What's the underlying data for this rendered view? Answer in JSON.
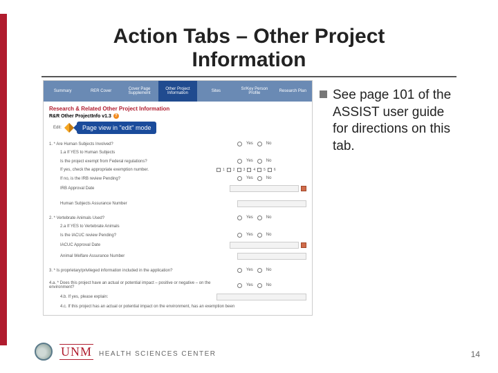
{
  "title": "Action Tabs – Other Project Information",
  "bullet_text": "See page 101 of the ASSIST user guide for directions on this tab.",
  "page_number": "14",
  "footer": {
    "unm": "UNM",
    "hsc": "HEALTH SCIENCES CENTER"
  },
  "callout": "Page view in \"edit\" mode",
  "shot": {
    "tabs": [
      "Summary",
      "RER Cover",
      "Cover Page Supplement",
      "Other Project Information",
      "Sites",
      "Sr/Key Person Profile",
      "Research Plan"
    ],
    "rr_title": "Research & Related Other Project Information",
    "rr_sub": "R&R Other ProjectInfo v1.3",
    "edit_label": "Edit:",
    "yes": "Yes",
    "no": "No",
    "q1": "1.  * Are Human Subjects Involved?",
    "q1a": "1.a If YES to Human Subjects",
    "q1a1": "Is the project exempt from Federal regulations?",
    "q1a2": "If yes, check the appropriate exemption number.",
    "q1a3": "If no, is the IRB review Pending?",
    "q1a4_lbl": "IRB Approval Date",
    "q1a5_lbl": "Human Subjects Assurance Number",
    "chk_nums": [
      "1",
      "2",
      "3",
      "4",
      "5",
      "6"
    ],
    "q2": "2.  * Vertebrate Animals Used?",
    "q2a": "2.a If YES to Vertebrate Animals",
    "q2a1": "Is the IACUC review Pending?",
    "q2a2_lbl": "IACUC Approval Date",
    "q2a3_lbl": "Animal Welfare Assurance Number",
    "q3": "3.  * Is proprietary/privileged information included in the application?",
    "q4a": "4.a.  * Does this project have an actual or potential impact – positive or negative – on the environment?",
    "q4b": "4.b. If yes, please explain:",
    "q4c": "4.c. If this project has an actual or potential impact on the environment, has an exemption been"
  }
}
